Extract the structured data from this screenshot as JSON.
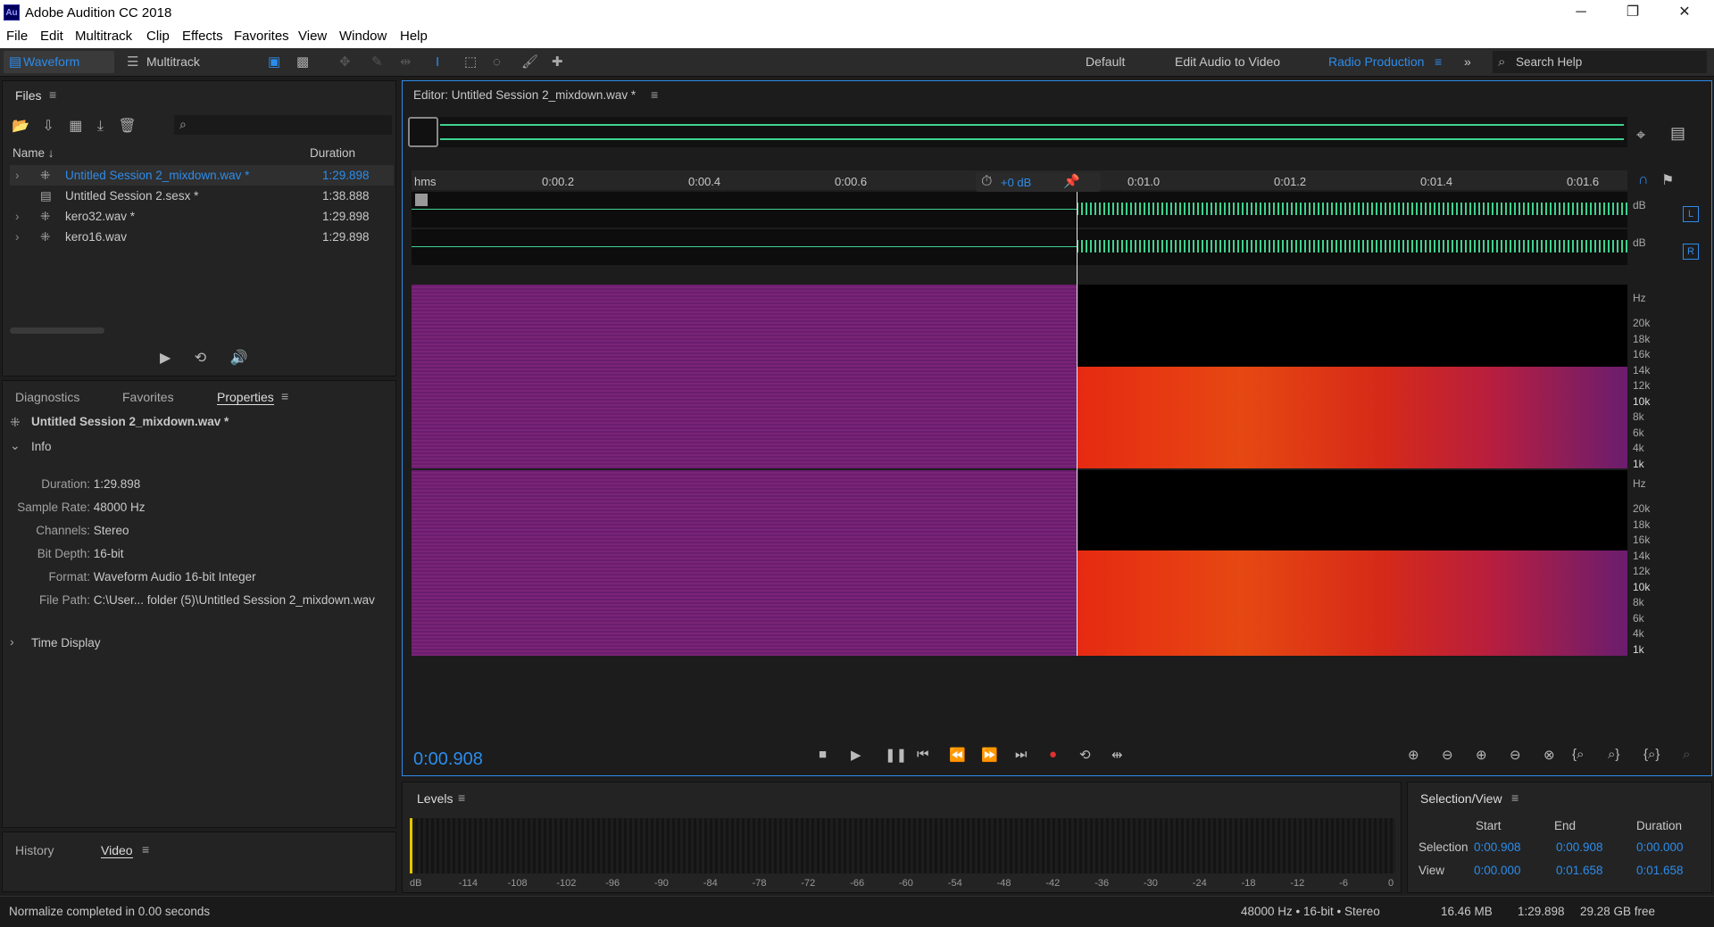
{
  "window": {
    "title": "Adobe Audition CC 2018",
    "icon_label": "Au"
  },
  "window_controls": {
    "minimize": "─",
    "maximize": "❐",
    "close": "✕"
  },
  "menu": [
    "File",
    "Edit",
    "Multitrack",
    "Clip",
    "Effects",
    "Favorites",
    "View",
    "Window",
    "Help"
  ],
  "toolbar": {
    "waveform_label": "Waveform",
    "multitrack_label": "Multitrack",
    "workspaces": [
      "Default",
      "Edit Audio to Video",
      "Radio Production"
    ],
    "active_workspace": "Radio Production",
    "search_placeholder": "Search Help"
  },
  "files_panel": {
    "title": "Files",
    "col_name": "Name",
    "col_duration": "Duration",
    "items": [
      {
        "name": "Untitled Session 2_mixdown.wav *",
        "duration": "1:29.898",
        "selected": true
      },
      {
        "name": "Untitled Session 2.sesx *",
        "duration": "1:38.888",
        "selected": false
      },
      {
        "name": "kero32.wav *",
        "duration": "1:29.898",
        "selected": false
      },
      {
        "name": "kero16.wav",
        "duration": "1:29.898",
        "selected": false
      }
    ]
  },
  "properties_panel": {
    "tabs": [
      "Diagnostics",
      "Favorites",
      "Properties"
    ],
    "active_tab": "Properties",
    "file_name": "Untitled Session 2_mixdown.wav *",
    "info_label": "Info",
    "info": [
      {
        "key": "Duration:",
        "value": "1:29.898"
      },
      {
        "key": "Sample Rate:",
        "value": "48000 Hz"
      },
      {
        "key": "Channels:",
        "value": "Stereo"
      },
      {
        "key": "Bit Depth:",
        "value": "16-bit"
      },
      {
        "key": "Format:",
        "value": "Waveform Audio 16-bit Integer"
      },
      {
        "key": "File Path:",
        "value": "C:\\User... folder (5)\\Untitled Session 2_mixdown.wav"
      }
    ],
    "time_display_label": "Time Display"
  },
  "bottom_left_tabs": [
    "History",
    "Video"
  ],
  "editor": {
    "title": "Editor: Untitled Session 2_mixdown.wav *",
    "ruler_unit": "hms",
    "ruler_ticks": [
      "0:00.2",
      "0:00.4",
      "0:00.6",
      "0:01.0",
      "0:01.2",
      "0:01.4",
      "0:01.6"
    ],
    "volume_label": "+0 dB",
    "db_label": "dB",
    "channel_left": "L",
    "channel_right": "R",
    "hz_label": "Hz",
    "freq_scale": [
      "20k",
      "18k",
      "16k",
      "14k",
      "12k",
      "10k",
      "8k",
      "6k",
      "4k",
      "1k"
    ],
    "current_time": "0:00.908",
    "playhead_fraction": 0.547
  },
  "levels_panel": {
    "title": "Levels",
    "scale": [
      "dB",
      "-114",
      "-108",
      "-102",
      "-96",
      "-90",
      "-84",
      "-78",
      "-72",
      "-66",
      "-60",
      "-54",
      "-48",
      "-42",
      "-36",
      "-30",
      "-24",
      "-18",
      "-12",
      "-6",
      "0"
    ]
  },
  "selection_view": {
    "title": "Selection/View",
    "headers": [
      "Start",
      "End",
      "Duration"
    ],
    "rows": [
      {
        "label": "Selection",
        "start": "0:00.908",
        "end": "0:00.908",
        "duration": "0:00.000"
      },
      {
        "label": "View",
        "start": "0:00.000",
        "end": "0:01.658",
        "duration": "0:01.658"
      }
    ]
  },
  "status": {
    "message": "Normalize completed in 0.00 seconds",
    "format": "48000 Hz • 16-bit • Stereo",
    "size": "16.46 MB",
    "duration": "1:29.898",
    "free": "29.28 GB free"
  },
  "colors": {
    "accent": "#2d8ceb",
    "waveform": "#3ed28f",
    "record": "#e03030"
  }
}
